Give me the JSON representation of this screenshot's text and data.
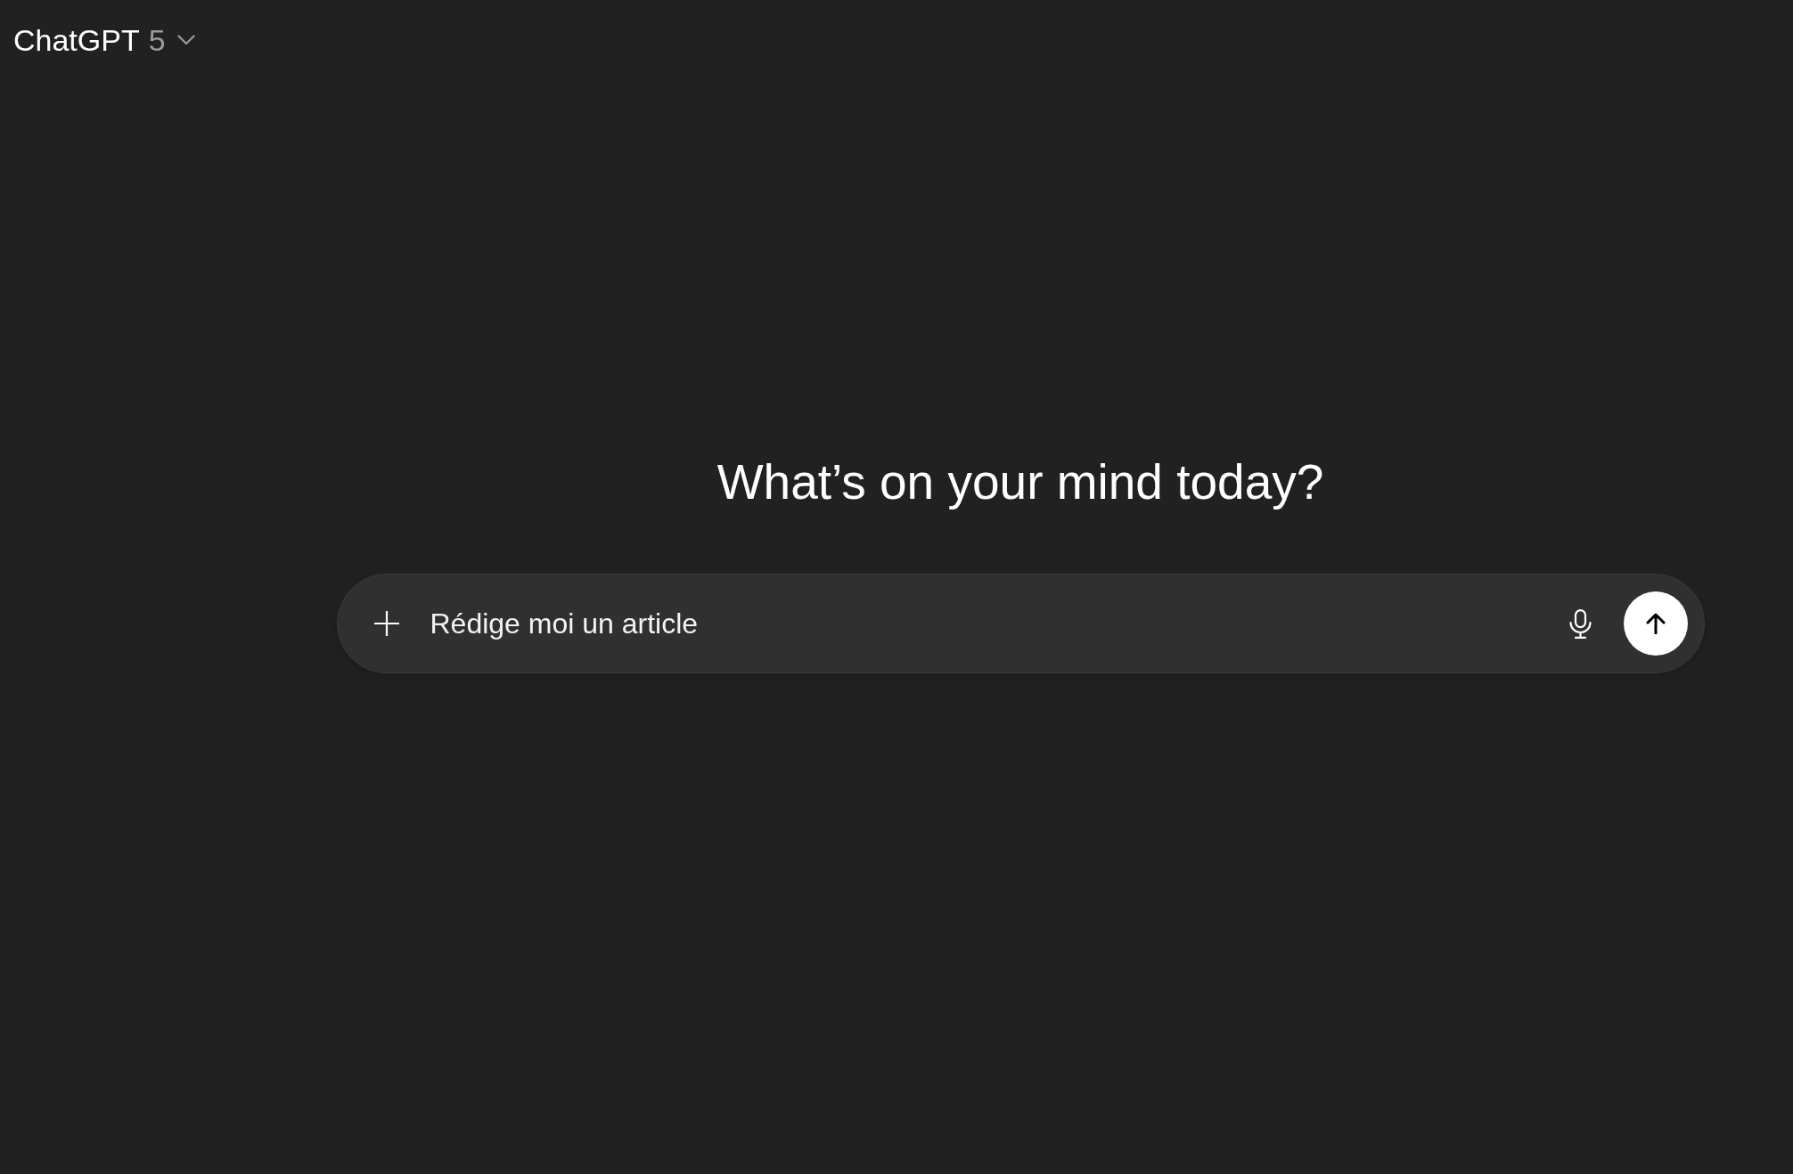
{
  "header": {
    "model_picker": {
      "name": "ChatGPT",
      "version": "5"
    }
  },
  "main": {
    "heading": "What’s on your mind today?",
    "composer": {
      "value": "Rédige moi un article"
    }
  }
}
